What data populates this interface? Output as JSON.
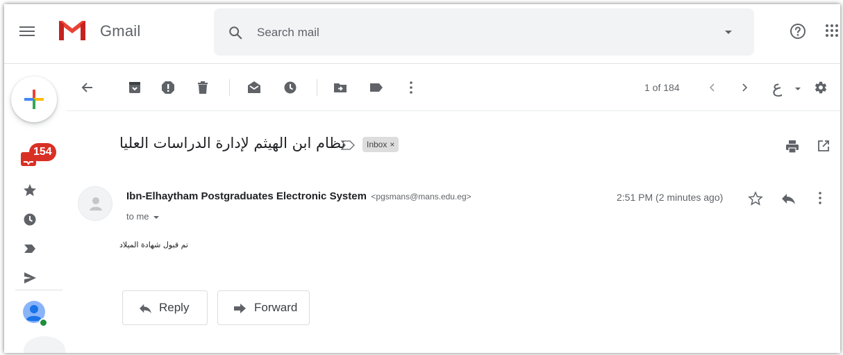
{
  "app": {
    "name": "Gmail",
    "search_placeholder": "Search mail"
  },
  "rail": {
    "inbox_badge": "154"
  },
  "toolbar": {
    "pager": "1 of 184",
    "language_glyph": "ع"
  },
  "thread": {
    "subject": "نظام ابن الهيثم لإدارة الدراسات العليا",
    "label": "Inbox",
    "label_remove": "×"
  },
  "message": {
    "sender_name": "Ibn-Elhaytham Postgraduates Electronic System",
    "sender_email": "<pgsmans@mans.edu.eg>",
    "to": "to me",
    "time": "2:51 PM (2 minutes ago)",
    "body": "تم قبول شهادة الميلاد"
  },
  "actions": {
    "reply": "Reply",
    "forward": "Forward"
  },
  "colors": {
    "accent_red": "#d93025",
    "icon_gray": "#5f6368",
    "online_green": "#1e8e3e",
    "search_bg": "#f1f3f4"
  }
}
